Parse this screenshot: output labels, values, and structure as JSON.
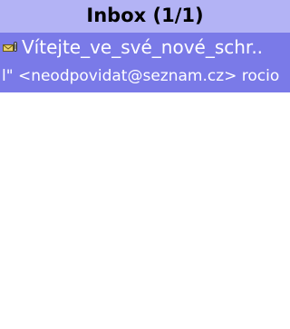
{
  "header": {
    "title": "Inbox (1/1)"
  },
  "messages": [
    {
      "subject": "Vítejte_ve_své_nové_schr..",
      "from": "l\" <neodpovidat@seznam.cz> rocio",
      "icon": "envelope-attachment-icon",
      "selected": true
    }
  ],
  "colors": {
    "header_bg": "#b3b3f5",
    "selected_row_bg": "#7a7ae8",
    "selected_text": "#ffffff",
    "background": "#ffffff"
  }
}
